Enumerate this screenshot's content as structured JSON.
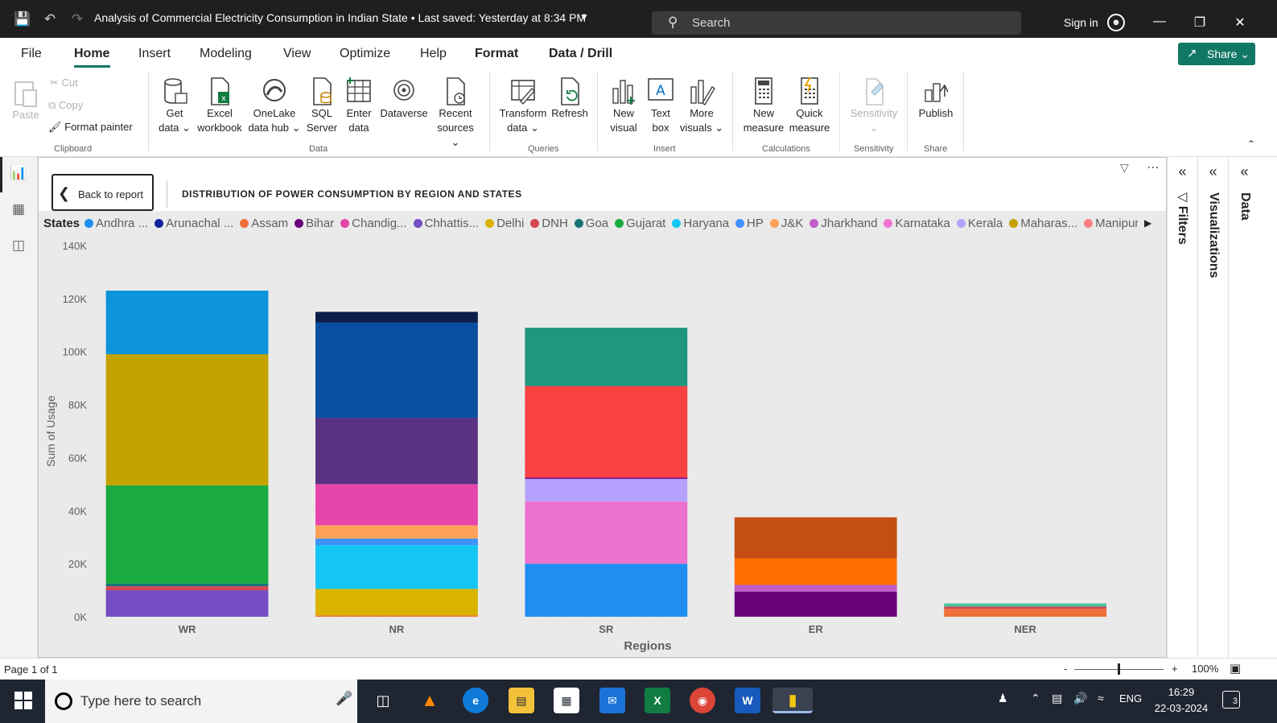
{
  "titlebar": {
    "title": "Analysis of Commercial Electricity Consumption in Indian State • Last saved: Yesterday at 8:34 PM",
    "search_placeholder": "Search",
    "sign_in": "Sign in"
  },
  "menu": {
    "items": [
      "File",
      "Home",
      "Insert",
      "Modeling",
      "View",
      "Optimize",
      "Help",
      "Format",
      "Data / Drill"
    ],
    "active": "Home",
    "share_label": "Share"
  },
  "ribbon": {
    "clipboard": {
      "paste": "Paste",
      "cut": "Cut",
      "copy": "Copy",
      "format_painter": "Format painter",
      "group": "Clipboard"
    },
    "data": {
      "group": "Data",
      "get_data": [
        "Get",
        "data ⌄"
      ],
      "excel": [
        "Excel",
        "workbook"
      ],
      "onelake": [
        "OneLake",
        "data hub ⌄"
      ],
      "sql": [
        "SQL",
        "Server"
      ],
      "enter": [
        "Enter",
        "data"
      ],
      "dataverse": [
        "Dataverse",
        ""
      ],
      "recent": [
        "Recent",
        "sources ⌄"
      ]
    },
    "queries": {
      "group": "Queries",
      "transform": [
        "Transform",
        "data ⌄"
      ],
      "refresh": [
        "Refresh",
        ""
      ]
    },
    "insert": {
      "group": "Insert",
      "new_visual": [
        "New",
        "visual"
      ],
      "text_box": [
        "Text",
        "box"
      ],
      "more_visuals": [
        "More",
        "visuals ⌄"
      ]
    },
    "calculations": {
      "group": "Calculations",
      "new_measure": [
        "New",
        "measure"
      ],
      "quick_measure": [
        "Quick",
        "measure"
      ]
    },
    "sensitivity": {
      "group": "Sensitivity",
      "label": [
        "Sensitivity",
        "⌄"
      ]
    },
    "share": {
      "group": "Share",
      "publish": [
        "Publish",
        ""
      ]
    }
  },
  "canvas": {
    "back_label": "Back to report",
    "report_title": "DISTRIBUTION OF POWER CONSUMPTION BY REGION AND STATES"
  },
  "panes": {
    "filters": "Filters",
    "visualizations": "Visualizations",
    "data": "Data"
  },
  "statusbar": {
    "page": "Page 1 of 1",
    "zoom": "100%",
    "minus": "-",
    "plus": "+"
  },
  "taskbar": {
    "search_placeholder": "Type here to search",
    "lang": "ENG",
    "time": "16:29",
    "date": "22-03-2024",
    "notifications": "3"
  },
  "colors": {
    "accent": "#117865",
    "titlebar": "#201f1e",
    "taskbar": "#1f2632",
    "canvas_bg": "#eaeaea"
  },
  "chart_data": {
    "type": "bar",
    "stacked": true,
    "title": "",
    "xlabel": "Regions",
    "ylabel": "Sum of Usage",
    "ylim": [
      0,
      140000
    ],
    "yticks": [
      "0K",
      "20K",
      "40K",
      "60K",
      "80K",
      "100K",
      "120K",
      "140K"
    ],
    "legend_title": "States",
    "legend_position": "top",
    "legend": [
      {
        "name": "Andhra ...",
        "color": "#1f8ef1"
      },
      {
        "name": "Arunachal ...",
        "color": "#12239e"
      },
      {
        "name": "Assam",
        "color": "#f0703a"
      },
      {
        "name": "Bihar",
        "color": "#6b007b"
      },
      {
        "name": "Chandig...",
        "color": "#e645ab"
      },
      {
        "name": "Chhattis...",
        "color": "#744ec2"
      },
      {
        "name": "Delhi",
        "color": "#d9b300"
      },
      {
        "name": "DNH",
        "color": "#d64550"
      },
      {
        "name": "Goa",
        "color": "#197278"
      },
      {
        "name": "Gujarat",
        "color": "#1aab40"
      },
      {
        "name": "Haryana",
        "color": "#15c6f4"
      },
      {
        "name": "HP",
        "color": "#4092ff"
      },
      {
        "name": "J&K",
        "color": "#ffa058"
      },
      {
        "name": "Jharkhand",
        "color": "#be5dc9"
      },
      {
        "name": "Karnataka",
        "color": "#f472d0"
      },
      {
        "name": "Kerala",
        "color": "#b5a1ff"
      },
      {
        "name": "Maharas...",
        "color": "#c4a200"
      },
      {
        "name": "Manipur",
        "color": "#ff8080"
      }
    ],
    "categories": [
      "WR",
      "NR",
      "SR",
      "ER",
      "NER"
    ],
    "stacks": [
      [
        {
          "value": 10000,
          "color": "#744ec2"
        },
        {
          "value": 1500,
          "color": "#d64550"
        },
        {
          "value": 1000,
          "color": "#197278"
        },
        {
          "value": 37000,
          "color": "#1aab40"
        },
        {
          "value": 49500,
          "color": "#c4a200"
        },
        {
          "value": 24000,
          "color": "#0e94d8"
        }
      ],
      [
        {
          "value": 500,
          "color": "#f0703a"
        },
        {
          "value": 10000,
          "color": "#d9b300"
        },
        {
          "value": 16500,
          "color": "#15c6f4"
        },
        {
          "value": 2500,
          "color": "#4092ff"
        },
        {
          "value": 5000,
          "color": "#ffa058"
        },
        {
          "value": 15500,
          "color": "#e645ab"
        },
        {
          "value": 25000,
          "color": "#5b3283"
        },
        {
          "value": 36000,
          "color": "#0a4fa0"
        },
        {
          "value": 4000,
          "color": "#0b1f4a"
        }
      ],
      [
        {
          "value": 20000,
          "color": "#1f8ef1"
        },
        {
          "value": 23500,
          "color": "#ec72cf"
        },
        {
          "value": 8500,
          "color": "#b5a1ff"
        },
        {
          "value": 500,
          "color": "#6b007b"
        },
        {
          "value": 34500,
          "color": "#f84141"
        },
        {
          "value": 22000,
          "color": "#1f9680"
        }
      ],
      [
        {
          "value": 9500,
          "color": "#6b007b"
        },
        {
          "value": 2500,
          "color": "#be5dc9"
        },
        {
          "value": 10000,
          "color": "#ff6c00"
        },
        {
          "value": 15500,
          "color": "#c54e14"
        }
      ],
      [
        {
          "value": 3000,
          "color": "#f0703a"
        },
        {
          "value": 800,
          "color": "#d64550"
        },
        {
          "value": 1200,
          "color": "#49c29c"
        }
      ]
    ]
  }
}
